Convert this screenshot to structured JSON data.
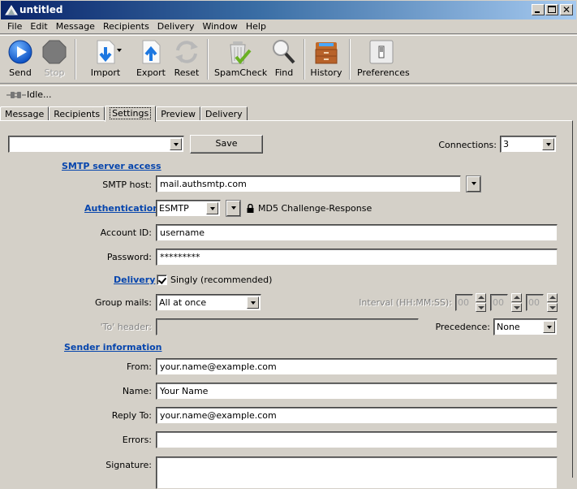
{
  "window": {
    "title": "untitled",
    "controls": {
      "minimize": "_",
      "maximize": "□",
      "close": "×"
    }
  },
  "menu": [
    "File",
    "Edit",
    "Message",
    "Recipients",
    "Delivery",
    "Window",
    "Help"
  ],
  "toolbar": {
    "send": "Send",
    "stop": "Stop",
    "import": "Import",
    "export": "Export",
    "reset": "Reset",
    "spamcheck": "SpamCheck",
    "find": "Find",
    "history": "History",
    "preferences": "Preferences"
  },
  "status": {
    "text": "Idle..."
  },
  "tabs": [
    "Message",
    "Recipients",
    "Settings",
    "Preview",
    "Delivery"
  ],
  "active_tab": "Settings",
  "settings": {
    "profile_combo": {
      "value": ""
    },
    "save_label": "Save",
    "connections": {
      "label": "Connections:",
      "value": "3"
    },
    "smtp_section": "SMTP server access",
    "smtp_host": {
      "label": "SMTP host:",
      "value": "mail.authsmtp.com"
    },
    "authentication": {
      "label": "Authentication",
      "protocol": "ESMTP",
      "method": "MD5 Challenge-Response"
    },
    "account_id": {
      "label": "Account ID:",
      "value": "username"
    },
    "password": {
      "label": "Password:",
      "value": "*********"
    },
    "delivery": {
      "label": "Delivery",
      "checkbox_label": "Singly (recommended)",
      "checked": true
    },
    "group_mails": {
      "label": "Group mails:",
      "value": "All at once"
    },
    "interval": {
      "label": "Interval (HH:MM:SS):",
      "hh": "00",
      "mm": "00",
      "ss": "00"
    },
    "to_header": {
      "label": "'To' header:",
      "value": ""
    },
    "precedence": {
      "label": "Precedence:",
      "value": "None"
    },
    "sender_section": "Sender information",
    "from": {
      "label": "From:",
      "value": "your.name@example.com"
    },
    "name": {
      "label": "Name:",
      "value": "Your Name"
    },
    "reply_to": {
      "label": "Reply To:",
      "value": "your.name@example.com"
    },
    "errors": {
      "label": "Errors:",
      "value": ""
    },
    "signature": {
      "label": "Signature:",
      "value": ""
    }
  }
}
